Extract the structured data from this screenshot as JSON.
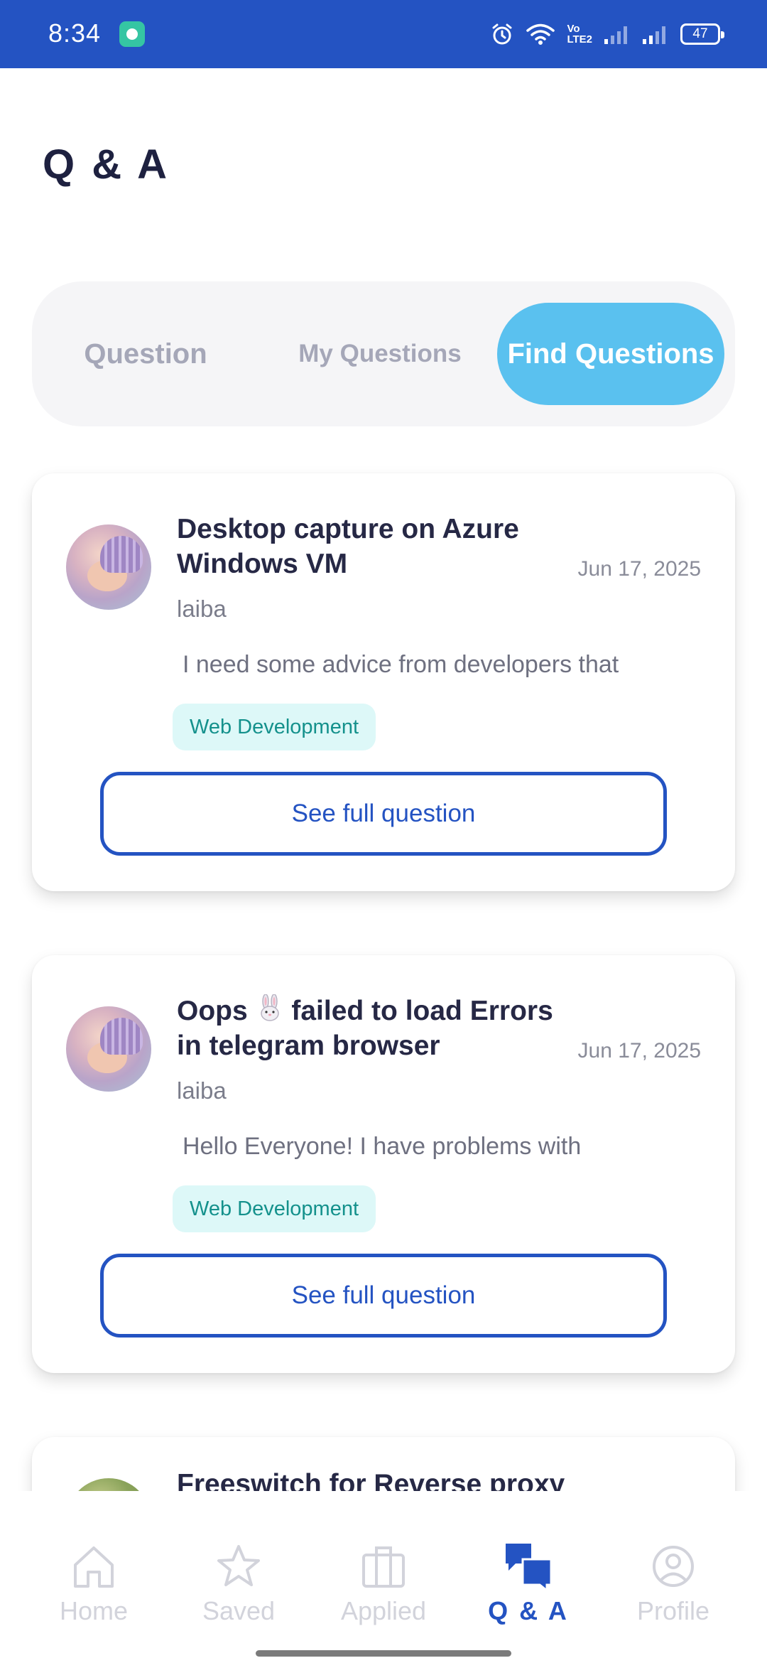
{
  "status_bar": {
    "time": "8:34",
    "volte_top": "Vo",
    "volte_bottom": "LTE2",
    "battery": "47",
    "icons": [
      "app-notification-icon",
      "alarm-icon",
      "wifi-icon",
      "volte-icon",
      "signal-icon",
      "signal-icon",
      "battery-icon"
    ]
  },
  "page": {
    "title": "Q & A"
  },
  "tabs": [
    {
      "label": "Question",
      "active": false
    },
    {
      "label": "My Questions",
      "active": false
    },
    {
      "label": "Find Questions",
      "active": true
    }
  ],
  "questions": [
    {
      "title": "Desktop capture on Azure Windows VM",
      "date": "Jun 17, 2025",
      "author": "laiba",
      "excerpt": "I need some advice from developers that",
      "tag": "Web Development",
      "button": "See full question"
    },
    {
      "title_before": "Oops",
      "title_after": " failed to load Errors in telegram browser",
      "emoji": "rabbit-emoji",
      "date": "Jun 17, 2025",
      "author": "laiba",
      "excerpt": "Hello Everyone! I have problems with",
      "tag": "Web Development",
      "button": "See full question"
    },
    {
      "title": "Freeswitch for Reverse proxy"
    }
  ],
  "bottom_nav": [
    {
      "label": "Home",
      "icon": "home-icon",
      "active": false
    },
    {
      "label": "Saved",
      "icon": "star-icon",
      "active": false
    },
    {
      "label": "Applied",
      "icon": "briefcase-icon",
      "active": false
    },
    {
      "label": "Q & A",
      "icon": "chat-bubbles-icon",
      "active": true
    },
    {
      "label": "Profile",
      "icon": "user-circle-icon",
      "active": false
    }
  ],
  "colors": {
    "status_bar": "#2453c2",
    "accent": "#2453c2",
    "active_tab": "#5ac1ef",
    "tag_bg": "#ddf8f8",
    "tag_text": "#14918c"
  }
}
